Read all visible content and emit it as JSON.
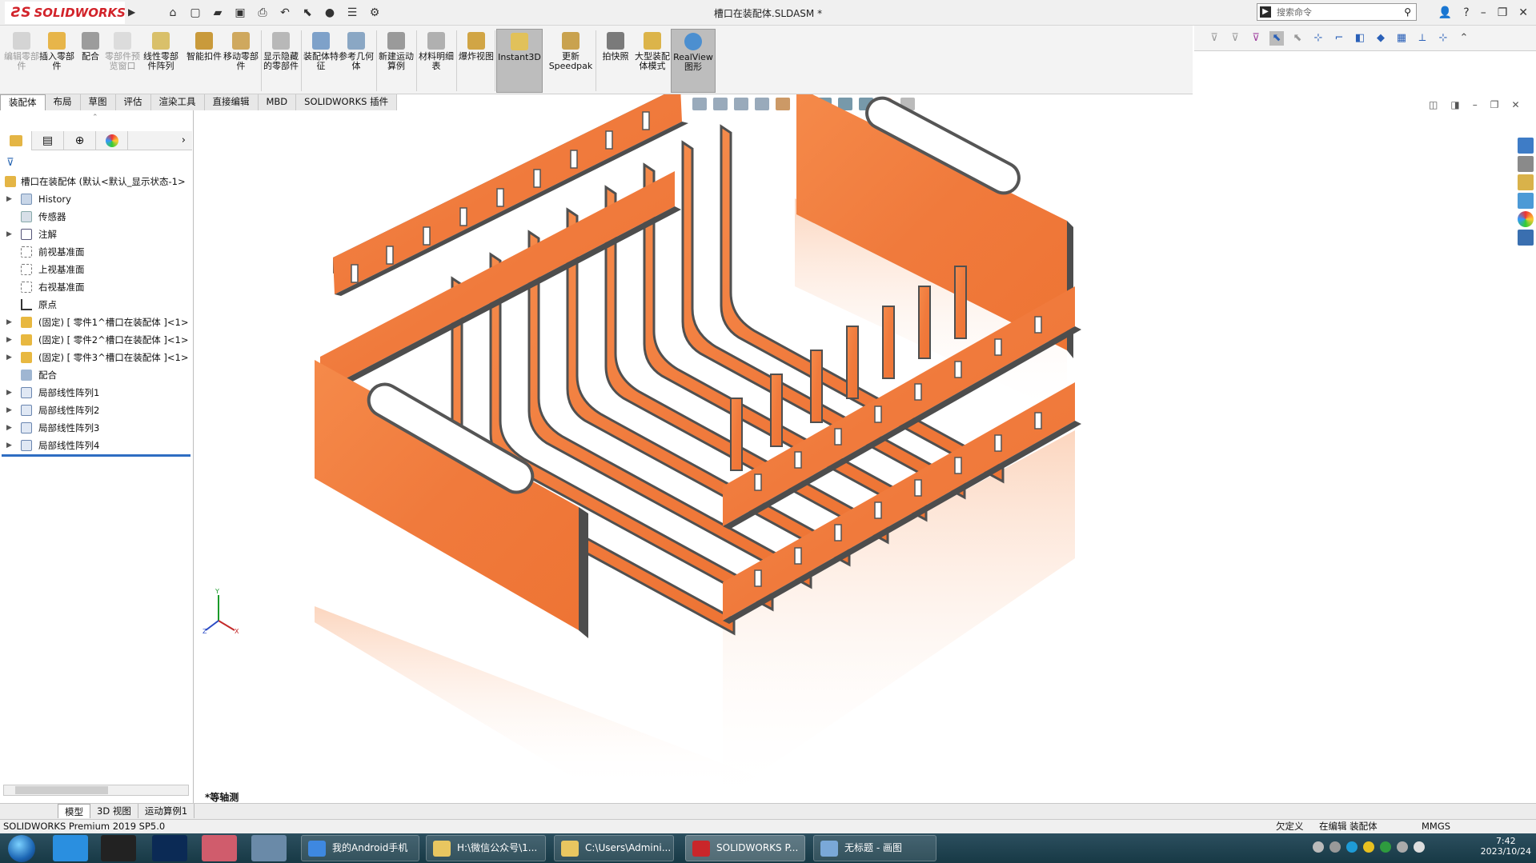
{
  "app": {
    "logo": "SOLIDWORKS",
    "document_title": "槽口在装配体.SLDASM *",
    "search_placeholder": "搜索命令"
  },
  "ribbon": [
    {
      "label": "编辑零部件",
      "disabled": true
    },
    {
      "label": "插入零部件"
    },
    {
      "label": "配合"
    },
    {
      "label": "零部件预览窗口",
      "disabled": true
    },
    {
      "label": "线性零部件阵列"
    },
    {
      "label": "智能扣件"
    },
    {
      "label": "移动零部件"
    },
    {
      "label": "显示隐藏的零部件"
    },
    {
      "label": "装配体特征"
    },
    {
      "label": "参考几何体"
    },
    {
      "label": "新建运动算例"
    },
    {
      "label": "材料明细表"
    },
    {
      "label": "爆炸视图"
    },
    {
      "label": "Instant3D",
      "active": true
    },
    {
      "label": "更新Speedpak"
    },
    {
      "label": "拍快照"
    },
    {
      "label": "大型装配体模式"
    },
    {
      "label": "RealView图形",
      "active": true
    }
  ],
  "tabs": [
    "装配体",
    "布局",
    "草图",
    "评估",
    "渲染工具",
    "直接编辑",
    "MBD",
    "SOLIDWORKS 插件"
  ],
  "tree": {
    "root": "槽口在装配体  (默认<默认_显示状态-1>",
    "items": [
      {
        "label": "History",
        "expand": true
      },
      {
        "label": "传感器"
      },
      {
        "label": "注解",
        "expand": true
      },
      {
        "label": "前视基准面"
      },
      {
        "label": "上视基准面"
      },
      {
        "label": "右视基准面"
      },
      {
        "label": "原点"
      },
      {
        "label": "(固定) [ 零件1^槽口在装配体 ]<1>",
        "expand": true
      },
      {
        "label": "(固定) [ 零件2^槽口在装配体 ]<1>",
        "expand": true
      },
      {
        "label": "(固定) [ 零件3^槽口在装配体 ]<1>",
        "expand": true
      },
      {
        "label": "配合"
      },
      {
        "label": "局部线性阵列1",
        "expand": true
      },
      {
        "label": "局部线性阵列2",
        "expand": true
      },
      {
        "label": "局部线性阵列3",
        "expand": true
      },
      {
        "label": "局部线性阵列4",
        "expand": true
      }
    ]
  },
  "bottom_tabs": [
    "模型",
    "3D 视图",
    "运动算例1"
  ],
  "view_label": "*等轴测",
  "status": {
    "product": "SOLIDWORKS Premium 2019 SP5.0",
    "defined": "欠定义",
    "editing": "在编辑 装配体",
    "units": "MMGS"
  },
  "taskbar": {
    "items": [
      "我的Android手机",
      "H:\\微信公众号\\1...",
      "C:\\Users\\Admini...",
      "SOLIDWORKS P...",
      "无标题 - 画图"
    ],
    "time": "7:42",
    "date": "2023/10/24"
  },
  "colors": {
    "wood": "#f07a3c",
    "wood_light": "#f8a06a",
    "edge": "#5b5b5b",
    "accent": "#2e6dc2"
  }
}
